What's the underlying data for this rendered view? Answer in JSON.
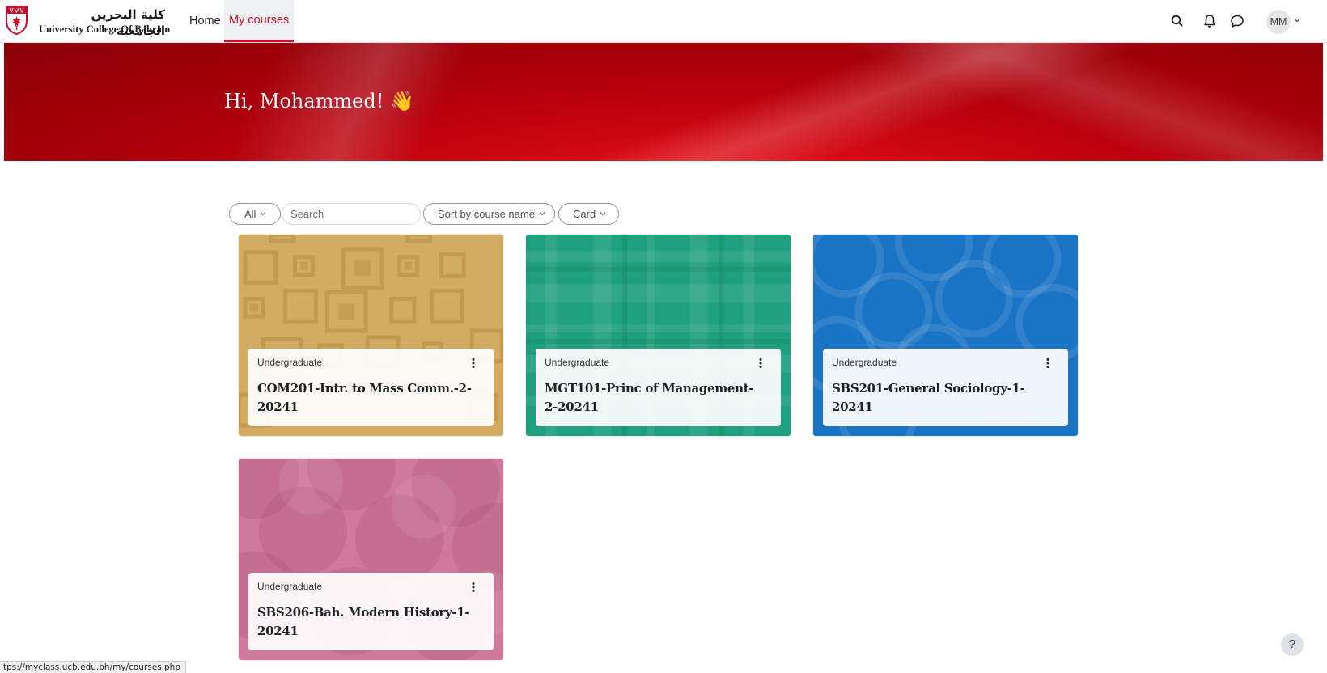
{
  "brand": {
    "name_ar": "كلية البحرين الجامعية",
    "name_en": "University College Of Bahrain"
  },
  "nav": {
    "home": "Home",
    "my_courses": "My courses",
    "user_initials": "MM"
  },
  "banner": {
    "greeting": "Hi, Mohammed! 👋"
  },
  "filters": {
    "grouping": "All",
    "search_placeholder": "Search",
    "sort": "Sort by course name",
    "view": "Card"
  },
  "courses": [
    {
      "category": "Undergraduate",
      "title": "COM201-Intr. to Mass Comm.-2-20241",
      "color": "#d2ac62"
    },
    {
      "category": "Undergraduate",
      "title": "MGT101-Princ of Management-2-20241",
      "color": "#1fa07c"
    },
    {
      "category": "Undergraduate",
      "title": "SBS201-General Sociology-1-20241",
      "color": "#1a74c6"
    },
    {
      "category": "Undergraduate",
      "title": "SBS206-Bah. Modern History-1-20241",
      "color": "#cf7a9c"
    }
  ],
  "help": {
    "label": "?"
  },
  "status_bar": {
    "url": "tps://myclass.ucb.edu.bh/my/courses.php"
  },
  "colors": {
    "accent": "#c8102e",
    "banner": "#b8000c"
  }
}
